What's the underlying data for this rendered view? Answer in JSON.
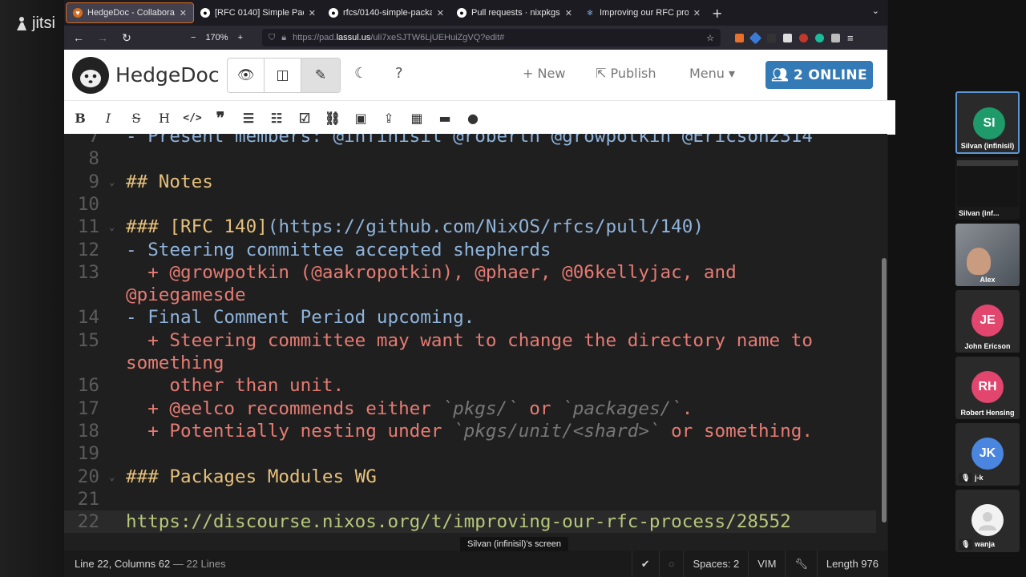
{
  "meeting": {
    "brand": "jitsi",
    "screen_tooltip": "Silvan (infinisil)'s screen"
  },
  "browser": {
    "tabs": [
      {
        "label": "HedgeDoc - Collaborativ",
        "icon": "hedgedoc-icon",
        "active": true
      },
      {
        "label": "[RFC 0140] Simple Packa",
        "icon": "github-icon",
        "active": false
      },
      {
        "label": "rfcs/0140-simple-packag",
        "icon": "github-icon",
        "active": false
      },
      {
        "label": "Pull requests · nixpkgs-ar",
        "icon": "github-icon",
        "active": false
      },
      {
        "label": "Improving our RFC proce",
        "icon": "discourse-icon",
        "active": false
      }
    ],
    "zoom": "170%",
    "url_prefix": "https://pad.",
    "url_host": "lassul.us",
    "url_path": "/uli7xeSJTW6LjUEHuiZgVQ?edit#"
  },
  "hedgedoc": {
    "brand": "HedgeDoc",
    "new_label": "New",
    "publish_label": "Publish",
    "menu_label": "Menu",
    "online_label": "2 ONLINE"
  },
  "toolbar": {
    "bold": "B",
    "italic": "I",
    "strike": "S",
    "heading": "H"
  },
  "editor": {
    "lines": [
      {
        "n": "7",
        "parts": [
          {
            "t": "- Present members: @infinisil @roberth @growpotkin @Ericson2314",
            "c": "c-blue"
          }
        ]
      },
      {
        "n": "8",
        "parts": []
      },
      {
        "n": "9",
        "fold": true,
        "parts": [
          {
            "t": "## Notes",
            "c": "c-head"
          }
        ]
      },
      {
        "n": "10",
        "parts": []
      },
      {
        "n": "11",
        "fold": true,
        "parts": [
          {
            "t": "### ",
            "c": "c-head"
          },
          {
            "t": "[RFC 140]",
            "c": "c-head"
          },
          {
            "t": "(https://github.com/NixOS/rfcs/pull/140)",
            "c": "c-link"
          }
        ]
      },
      {
        "n": "12",
        "parts": [
          {
            "t": "- Steering committee accepted shepherds",
            "c": "c-blue"
          }
        ]
      },
      {
        "n": "13",
        "parts": [
          {
            "t": "  + @growpotkin (@aakropotkin), @phaer, @06kellyjac, and",
            "c": "c-red"
          }
        ]
      },
      {
        "n": "",
        "parts": [
          {
            "t": "@piegamesde",
            "c": "c-red"
          }
        ]
      },
      {
        "n": "14",
        "parts": [
          {
            "t": "- Final Comment Period upcoming.",
            "c": "c-blue"
          }
        ]
      },
      {
        "n": "15",
        "parts": [
          {
            "t": "  + Steering committee may want to change the directory name to",
            "c": "c-red"
          }
        ]
      },
      {
        "n": "",
        "parts": [
          {
            "t": "something",
            "c": "c-red"
          }
        ]
      },
      {
        "n": "16",
        "parts": [
          {
            "t": "    other than unit.",
            "c": "c-red"
          }
        ]
      },
      {
        "n": "17",
        "parts": [
          {
            "t": "  + @eelco recommends either ",
            "c": "c-red"
          },
          {
            "t": "`pkgs/`",
            "c": "c-ital"
          },
          {
            "t": " or ",
            "c": "c-red"
          },
          {
            "t": "`packages/`",
            "c": "c-ital"
          },
          {
            "t": ".",
            "c": "c-red"
          }
        ]
      },
      {
        "n": "18",
        "parts": [
          {
            "t": "  + Potentially nesting under ",
            "c": "c-red"
          },
          {
            "t": "`pkgs/unit/<shard>`",
            "c": "c-ital"
          },
          {
            "t": " or something.",
            "c": "c-red"
          }
        ]
      },
      {
        "n": "19",
        "parts": []
      },
      {
        "n": "20",
        "fold": true,
        "parts": [
          {
            "t": "### Packages Modules WG",
            "c": "c-head"
          }
        ]
      },
      {
        "n": "21",
        "parts": []
      },
      {
        "n": "22",
        "current": true,
        "parts": [
          {
            "t": "https://discourse.nixos.org/t/improving-our-rfc-process/28552",
            "c": "c-green"
          }
        ]
      }
    ]
  },
  "status": {
    "position": "Line 22, Columns 62",
    "lines": "— 22 Lines",
    "spaces": "Spaces: 2",
    "keymap": "VIM",
    "length": "Length 976"
  },
  "participants": [
    {
      "initials": "SI",
      "name": "Silvan (infinisil)",
      "color": "#1f9a6a",
      "selected": true
    },
    {
      "initials": "",
      "name": "Silvan (inf...",
      "color": "#1a1a1a",
      "screen": true
    },
    {
      "initials": "",
      "name": "Alex",
      "color": "#6b6b6b",
      "photo": true
    },
    {
      "initials": "JE",
      "name": "John Ericson",
      "color": "#e2466e"
    },
    {
      "initials": "RH",
      "name": "Robert Hensing",
      "color": "#e2466e"
    },
    {
      "initials": "JK",
      "name": "j-k",
      "color": "#4a86e0",
      "muted": true
    },
    {
      "initials": "",
      "name": "wanja",
      "color": "#f2f2f2",
      "muted": true,
      "blank": true
    }
  ]
}
